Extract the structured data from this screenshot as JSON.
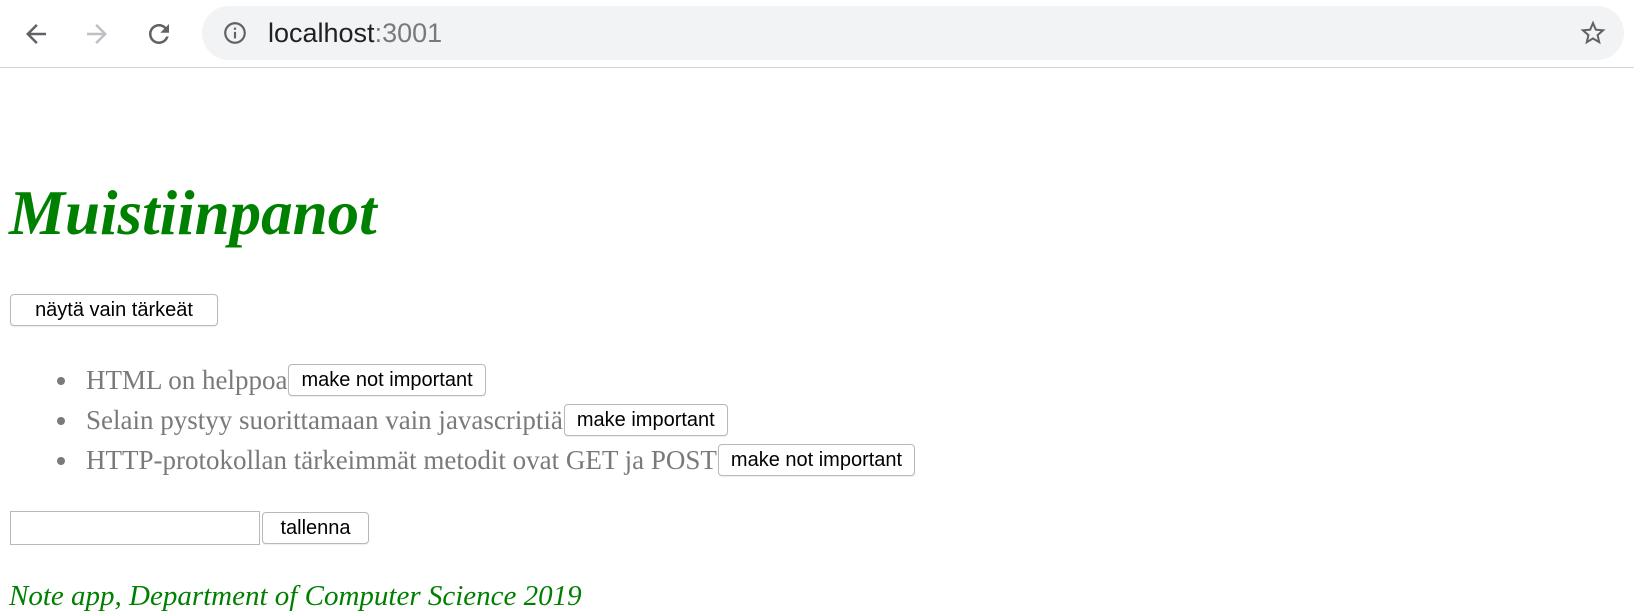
{
  "browser": {
    "url_host": "localhost",
    "url_port": ":3001"
  },
  "page": {
    "title": "Muistiinpanot",
    "show_button_label": "näytä vain tärkeät",
    "notes": [
      {
        "content": "HTML on helppoa",
        "toggle_label": "make not important"
      },
      {
        "content": "Selain pystyy suorittamaan vain javascriptiä",
        "toggle_label": "make important"
      },
      {
        "content": "HTTP-protokollan tärkeimmät metodit ovat GET ja POST",
        "toggle_label": "make not important"
      }
    ],
    "new_note_value": "",
    "save_button_label": "tallenna",
    "footer": "Note app, Department of Computer Science 2019"
  },
  "colors": {
    "title": "#008000",
    "note_text": "#7a7a7a",
    "omnibox_bg": "#f1f3f4"
  },
  "icons": [
    "back-arrow-icon",
    "forward-arrow-icon",
    "reload-icon",
    "info-icon",
    "star-icon"
  ]
}
